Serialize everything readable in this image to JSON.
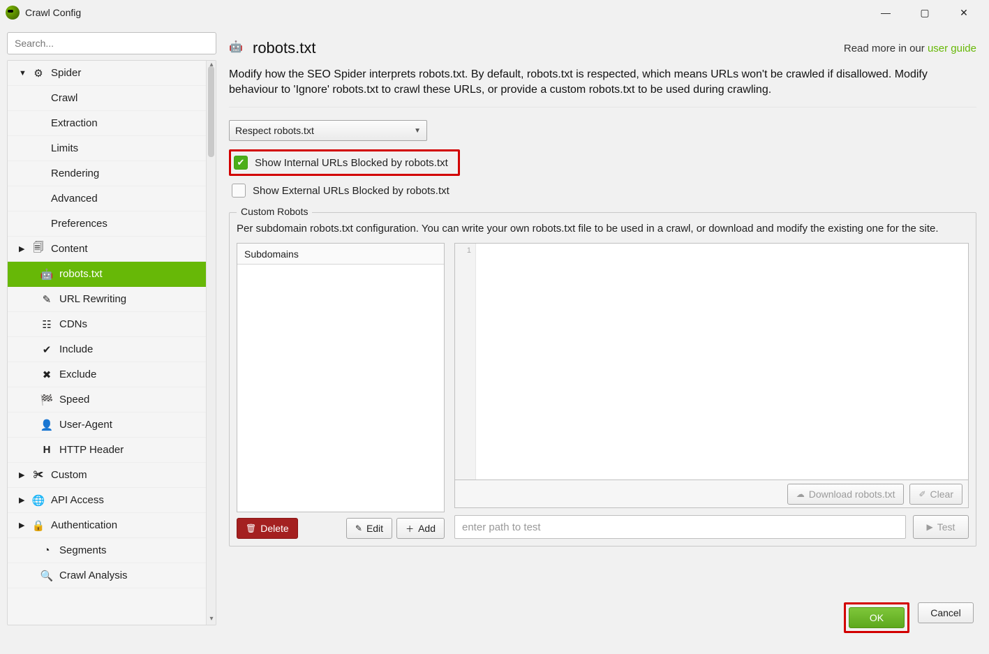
{
  "window": {
    "title": "Crawl Config"
  },
  "search": {
    "placeholder": "Search..."
  },
  "tree": {
    "spider": {
      "label": "Spider",
      "items": {
        "crawl": "Crawl",
        "extraction": "Extraction",
        "limits": "Limits",
        "rendering": "Rendering",
        "advanced": "Advanced",
        "preferences": "Preferences"
      }
    },
    "content": {
      "label": "Content"
    },
    "robots": {
      "label": "robots.txt"
    },
    "url_rewriting": {
      "label": "URL Rewriting"
    },
    "cdns": {
      "label": "CDNs"
    },
    "include": {
      "label": "Include"
    },
    "exclude": {
      "label": "Exclude"
    },
    "speed": {
      "label": "Speed"
    },
    "user_agent": {
      "label": "User-Agent"
    },
    "http_header": {
      "label": "HTTP Header"
    },
    "custom": {
      "label": "Custom"
    },
    "api_access": {
      "label": "API Access"
    },
    "authentication": {
      "label": "Authentication"
    },
    "segments": {
      "label": "Segments"
    },
    "crawl_analysis": {
      "label": "Crawl Analysis"
    }
  },
  "main": {
    "title": "robots.txt",
    "readmore_prefix": "Read more in our ",
    "readmore_link": "user guide",
    "desc": "Modify how the SEO Spider interprets robots.txt. By default, robots.txt is respected, which means URLs won't be crawled if disallowed. Modify behaviour to 'Ignore' robots.txt to crawl these URLs, or provide a custom robots.txt to be used during crawling.",
    "dropdown": {
      "selected": "Respect robots.txt"
    },
    "check_internal": "Show Internal URLs Blocked by robots.txt",
    "check_external": "Show External URLs Blocked by robots.txt",
    "custom_robots": {
      "legend": "Custom Robots",
      "desc": "Per subdomain robots.txt configuration. You can write your own robots.txt file to be used in a crawl, or download and modify the existing one for the site.",
      "subdomains_header": "Subdomains",
      "editor_first_line": "1",
      "delete": "Delete",
      "edit": "Edit",
      "add": "Add",
      "download": "Download robots.txt",
      "clear": "Clear",
      "test_placeholder": "enter path to test",
      "test_btn": "Test"
    }
  },
  "footer": {
    "ok": "OK",
    "cancel": "Cancel"
  }
}
